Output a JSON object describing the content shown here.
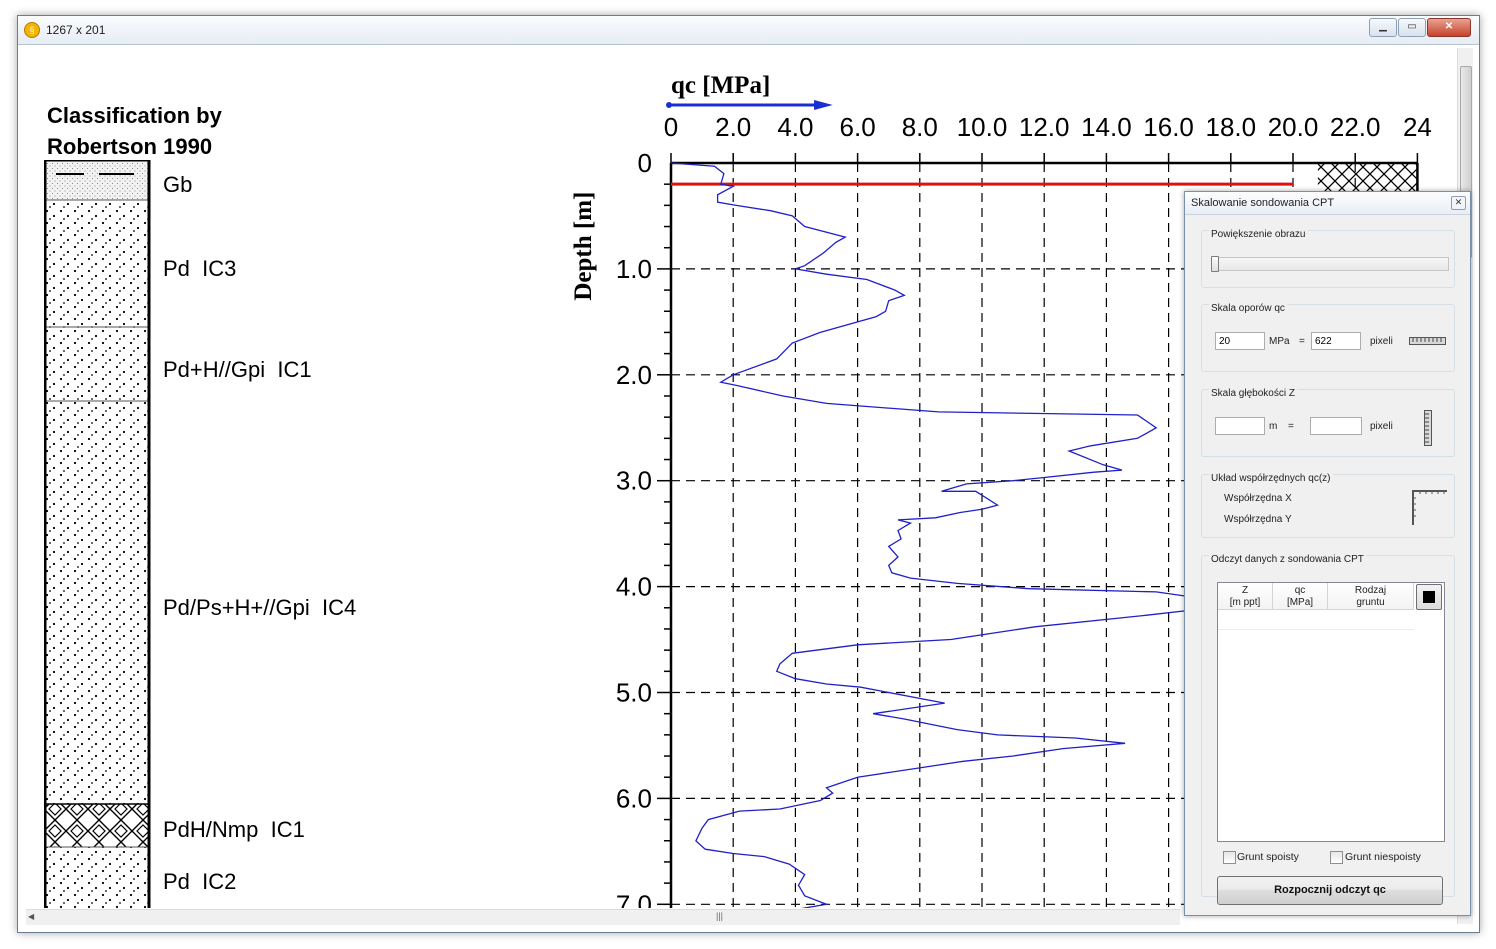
{
  "window": {
    "title": "1267 x 201",
    "app_icon": "app-icon"
  },
  "classification": {
    "title": "Classification by\nRobertson 1990",
    "layers": [
      {
        "label": "Gb",
        "pattern": "sand-with-dashes"
      },
      {
        "label": "Pd  IC3",
        "pattern": "dotted-sand"
      },
      {
        "label": "Pd+H//Gpi  IC1",
        "pattern": "dotted-sand"
      },
      {
        "label": "Pd/Ps+H+//Gpi  IC4",
        "pattern": "dotted-sand"
      },
      {
        "label": "PdH/Nmp  IC1",
        "pattern": "hatched-organic"
      },
      {
        "label": "Pd  IC2",
        "pattern": "dotted-sand"
      }
    ]
  },
  "chart_data": {
    "type": "line",
    "title": "qc [MPa]",
    "xlabel": "qc [MPa]",
    "ylabel": "Depth [m]",
    "xlim": [
      0,
      24
    ],
    "ylim": [
      7.2,
      0
    ],
    "x_tick_labels": [
      "0",
      "2.0",
      "4.0",
      "6.0",
      "8.0",
      "10.0",
      "12.0",
      "14.0",
      "16.0",
      "18.0",
      "20.0",
      "22.0",
      "24"
    ],
    "y_tick_labels": [
      "0",
      "1.0",
      "2.0",
      "3.0",
      "4.0",
      "5.0",
      "6.0",
      "7.0"
    ],
    "grid": true,
    "reference_line_depth": 0.2,
    "reference_line_x_end": 20,
    "series": [
      {
        "color": "#2020c8",
        "points": [
          [
            0,
            0.0
          ],
          [
            1.4,
            0.03
          ],
          [
            1.7,
            0.1
          ],
          [
            1.6,
            0.2
          ],
          [
            2.0,
            0.22
          ],
          [
            1.5,
            0.3
          ],
          [
            1.5,
            0.37
          ],
          [
            2.1,
            0.4
          ],
          [
            3.2,
            0.45
          ],
          [
            3.9,
            0.5
          ],
          [
            4.3,
            0.6
          ],
          [
            5.6,
            0.7
          ],
          [
            5.3,
            0.75
          ],
          [
            4.9,
            0.85
          ],
          [
            4.3,
            0.97
          ],
          [
            4.0,
            1.0
          ],
          [
            5.0,
            1.05
          ],
          [
            6.3,
            1.1
          ],
          [
            7.2,
            1.2
          ],
          [
            7.5,
            1.25
          ],
          [
            7.0,
            1.3
          ],
          [
            6.9,
            1.4
          ],
          [
            6.6,
            1.45
          ],
          [
            4.8,
            1.6
          ],
          [
            3.9,
            1.7
          ],
          [
            3.4,
            1.85
          ],
          [
            2.0,
            2.0
          ],
          [
            1.6,
            2.07
          ],
          [
            2.1,
            2.1
          ],
          [
            3.6,
            2.2
          ],
          [
            5.0,
            2.27
          ],
          [
            8.6,
            2.35
          ],
          [
            15.0,
            2.38
          ],
          [
            15.6,
            2.5
          ],
          [
            15.0,
            2.6
          ],
          [
            13.5,
            2.67
          ],
          [
            12.8,
            2.72
          ],
          [
            13.9,
            2.85
          ],
          [
            14.5,
            2.9
          ],
          [
            13.6,
            2.92
          ],
          [
            12.0,
            2.97
          ],
          [
            11.0,
            3.0
          ],
          [
            9.5,
            3.03
          ],
          [
            8.7,
            3.1
          ],
          [
            9.8,
            3.1
          ],
          [
            10.5,
            3.23
          ],
          [
            10.0,
            3.27
          ],
          [
            9.3,
            3.3
          ],
          [
            8.5,
            3.35
          ],
          [
            7.3,
            3.37
          ],
          [
            7.7,
            3.4
          ],
          [
            7.3,
            3.47
          ],
          [
            7.4,
            3.55
          ],
          [
            7.0,
            3.62
          ],
          [
            7.3,
            3.72
          ],
          [
            7.0,
            3.8
          ],
          [
            7.1,
            3.87
          ],
          [
            7.7,
            3.92
          ],
          [
            9.2,
            3.97
          ],
          [
            11.5,
            4.02
          ],
          [
            15.6,
            4.05
          ],
          [
            16.8,
            4.1
          ],
          [
            17.3,
            4.17
          ],
          [
            16.8,
            4.22
          ],
          [
            15.3,
            4.27
          ],
          [
            11.7,
            4.38
          ],
          [
            9.0,
            4.5
          ],
          [
            6.0,
            4.55
          ],
          [
            3.9,
            4.63
          ],
          [
            3.5,
            4.73
          ],
          [
            3.4,
            4.8
          ],
          [
            4.0,
            4.87
          ],
          [
            5.0,
            4.92
          ],
          [
            6.1,
            4.95
          ],
          [
            8.8,
            5.1
          ],
          [
            6.5,
            5.2
          ],
          [
            7.5,
            5.25
          ],
          [
            9.2,
            5.35
          ],
          [
            10.5,
            5.4
          ],
          [
            13.0,
            5.43
          ],
          [
            14.6,
            5.48
          ],
          [
            12.6,
            5.53
          ],
          [
            11.0,
            5.6
          ],
          [
            9.4,
            5.65
          ],
          [
            6.0,
            5.8
          ],
          [
            5.0,
            5.9
          ],
          [
            5.2,
            5.95
          ],
          [
            4.8,
            6.02
          ],
          [
            3.5,
            6.1
          ],
          [
            2.2,
            6.12
          ],
          [
            1.2,
            6.2
          ],
          [
            1.0,
            6.28
          ],
          [
            0.8,
            6.4
          ],
          [
            1.1,
            6.48
          ],
          [
            2.0,
            6.52
          ],
          [
            3.0,
            6.55
          ],
          [
            3.8,
            6.62
          ],
          [
            4.3,
            6.72
          ],
          [
            4.1,
            6.82
          ],
          [
            4.3,
            6.92
          ],
          [
            5.0,
            7.0
          ],
          [
            4.0,
            7.05
          ],
          [
            2.4,
            7.12
          ],
          [
            1.2,
            7.18
          ],
          [
            0.9,
            7.22
          ]
        ]
      }
    ]
  },
  "dialog": {
    "title": "Skalowanie sondowania CPT",
    "zoom_group": {
      "label": "Powiększenie obrazu",
      "slider_value": 0
    },
    "qc_scale": {
      "label": "Skala oporów qc",
      "value": "20",
      "unit": "MPa",
      "equals": "=",
      "pixels_value": "622",
      "pixels_label": "pixeli",
      "icon": "horizontal-ruler-icon"
    },
    "z_scale": {
      "label": "Skala głębokości Z",
      "value": "",
      "unit": "m",
      "equals": "=",
      "pixels_value": "",
      "pixels_label": "pixeli",
      "icon": "vertical-ruler-icon"
    },
    "coords": {
      "label": "Układ współrzędnych qc(z)",
      "x_label": "Współrzędna X",
      "y_label": "Współrzędna Y",
      "icon": "axis-corner-icon"
    },
    "reading": {
      "label": "Odczyt danych z sondowania CPT",
      "columns": [
        "Z\n[m ppt]",
        "qc\n[MPa]",
        "Rodzaj\ngruntu"
      ],
      "color_button_icon": "black-square-icon"
    },
    "check_cohesive": "Grunt spoisty",
    "check_noncohesive": "Grunt niespoisty",
    "start_button": "Rozpocznij odczyt qc"
  }
}
